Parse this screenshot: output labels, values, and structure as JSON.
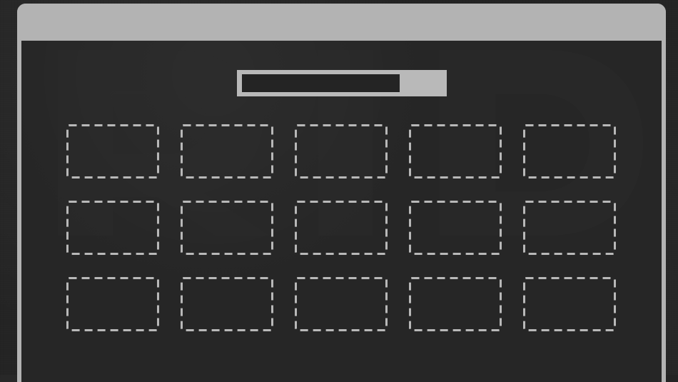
{
  "ui": {
    "progress": 0.79,
    "slots": [
      {},
      {},
      {},
      {},
      {},
      {},
      {},
      {},
      {},
      {},
      {},
      {},
      {},
      {},
      {}
    ]
  }
}
